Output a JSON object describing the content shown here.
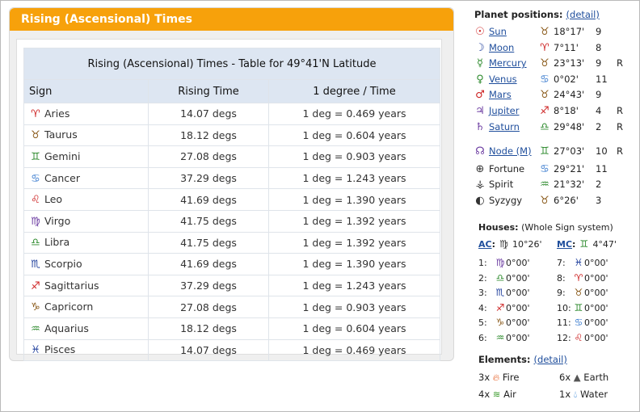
{
  "panel": {
    "title": "Rising (Ascensional) Times"
  },
  "table": {
    "caption": "Rising (Ascensional) Times - Table for 49°41'N Latitude",
    "headers": [
      "Sign",
      "Rising Time",
      "1 degree / Time"
    ],
    "rows": [
      {
        "glyph": "♈",
        "sign": "Aries",
        "rising": "14.07 degs",
        "per_degree": "1 deg = 0.469 years"
      },
      {
        "glyph": "♉",
        "sign": "Taurus",
        "rising": "18.12 degs",
        "per_degree": "1 deg = 0.604 years"
      },
      {
        "glyph": "♊",
        "sign": "Gemini",
        "rising": "27.08 degs",
        "per_degree": "1 deg = 0.903 years"
      },
      {
        "glyph": "♋",
        "sign": "Cancer",
        "rising": "37.29 degs",
        "per_degree": "1 deg = 1.243 years"
      },
      {
        "glyph": "♌",
        "sign": "Leo",
        "rising": "41.69 degs",
        "per_degree": "1 deg = 1.390 years"
      },
      {
        "glyph": "♍",
        "sign": "Virgo",
        "rising": "41.75 degs",
        "per_degree": "1 deg = 1.392 years"
      },
      {
        "glyph": "♎",
        "sign": "Libra",
        "rising": "41.75 degs",
        "per_degree": "1 deg = 1.392 years"
      },
      {
        "glyph": "♏",
        "sign": "Scorpio",
        "rising": "41.69 degs",
        "per_degree": "1 deg = 1.390 years"
      },
      {
        "glyph": "♐",
        "sign": "Sagittarius",
        "rising": "37.29 degs",
        "per_degree": "1 deg = 1.243 years"
      },
      {
        "glyph": "♑",
        "sign": "Capricorn",
        "rising": "27.08 degs",
        "per_degree": "1 deg = 0.903 years"
      },
      {
        "glyph": "♒",
        "sign": "Aquarius",
        "rising": "18.12 degs",
        "per_degree": "1 deg = 0.604 years"
      },
      {
        "glyph": "♓",
        "sign": "Pisces",
        "rising": "14.07 degs",
        "per_degree": "1 deg = 0.469 years"
      }
    ]
  },
  "planets": {
    "title": "Planet positions:",
    "detail_link": "(detail)",
    "items": [
      {
        "glyph": "☉",
        "name": "Sun",
        "link": true,
        "sign_glyph": "♉",
        "pos": "18°17'",
        "house": "9",
        "retro": ""
      },
      {
        "glyph": "☽",
        "name": "Moon",
        "link": true,
        "sign_glyph": "♈",
        "pos": "7°11'",
        "house": "8",
        "retro": ""
      },
      {
        "glyph": "☿",
        "name": "Mercury",
        "link": true,
        "sign_glyph": "♉",
        "pos": "23°13'",
        "house": "9",
        "retro": "R"
      },
      {
        "glyph": "♀",
        "name": "Venus",
        "link": true,
        "sign_glyph": "♋",
        "pos": "0°02'",
        "house": "11",
        "retro": ""
      },
      {
        "glyph": "♂",
        "name": "Mars",
        "link": true,
        "sign_glyph": "♉",
        "pos": "24°43'",
        "house": "9",
        "retro": ""
      },
      {
        "glyph": "♃",
        "name": "Jupiter",
        "link": true,
        "sign_glyph": "♐",
        "pos": "8°18'",
        "house": "4",
        "retro": "R"
      },
      {
        "glyph": "♄",
        "name": "Saturn",
        "link": true,
        "sign_glyph": "♎",
        "pos": "29°48'",
        "house": "2",
        "retro": "R"
      },
      {
        "glyph": "☊",
        "name": "Node (M)",
        "link": true,
        "sign_glyph": "♊",
        "pos": "27°03'",
        "house": "10",
        "retro": "R"
      },
      {
        "glyph": "⊕",
        "name": "Fortune",
        "link": false,
        "sign_glyph": "♋",
        "pos": "29°21'",
        "house": "11",
        "retro": ""
      },
      {
        "glyph": "⚶",
        "name": "Spirit",
        "link": false,
        "sign_glyph": "♒",
        "pos": "21°32'",
        "house": "2",
        "retro": ""
      },
      {
        "glyph": "◐",
        "name": "Syzygy",
        "link": false,
        "sign_glyph": "♉",
        "pos": "6°26'",
        "house": "3",
        "retro": ""
      }
    ]
  },
  "houses": {
    "title": "Houses:",
    "system": "(Whole Sign system)",
    "ac_label": "AC",
    "ac_glyph": "♍",
    "ac_pos": "10°26'",
    "mc_label": "MC",
    "mc_glyph": "♊",
    "mc_pos": "4°47'",
    "items": [
      {
        "n": "1:",
        "glyph": "♍",
        "pos": "0°00'"
      },
      {
        "n": "2:",
        "glyph": "♎",
        "pos": "0°00'"
      },
      {
        "n": "3:",
        "glyph": "♏",
        "pos": "0°00'"
      },
      {
        "n": "4:",
        "glyph": "♐",
        "pos": "0°00'"
      },
      {
        "n": "5:",
        "glyph": "♑",
        "pos": "0°00'"
      },
      {
        "n": "6:",
        "glyph": "♒",
        "pos": "0°00'"
      },
      {
        "n": "7:",
        "glyph": "♓",
        "pos": "0°00'"
      },
      {
        "n": "8:",
        "glyph": "♈",
        "pos": "0°00'"
      },
      {
        "n": "9:",
        "glyph": "♉",
        "pos": "0°00'"
      },
      {
        "n": "10:",
        "glyph": "♊",
        "pos": "0°00'"
      },
      {
        "n": "11:",
        "glyph": "♋",
        "pos": "0°00'"
      },
      {
        "n": "12:",
        "glyph": "♌",
        "pos": "0°00'"
      }
    ]
  },
  "elements": {
    "title": "Elements:",
    "detail_link": "(detail)",
    "items": [
      {
        "count": "3x",
        "name": "Fire",
        "icon": "fire-icon"
      },
      {
        "count": "6x",
        "name": "Earth",
        "icon": "earth-icon"
      },
      {
        "count": "4x",
        "name": "Air",
        "icon": "air-icon"
      },
      {
        "count": "1x",
        "name": "Water",
        "icon": "water-icon"
      }
    ]
  },
  "colors": {
    "header_orange": "#f7a10b",
    "table_header": "#dde6f2",
    "link": "#1f4e9c"
  }
}
